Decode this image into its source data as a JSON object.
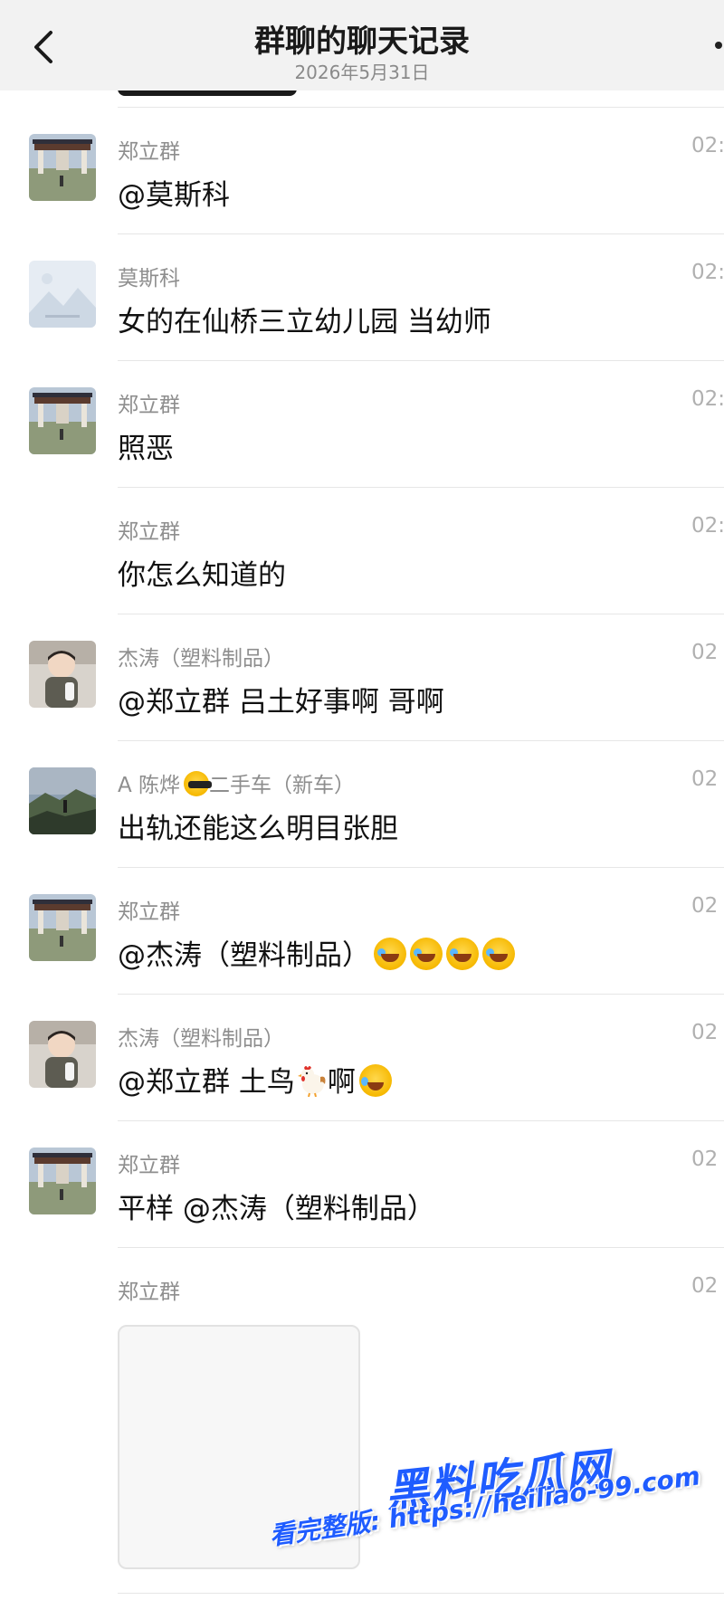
{
  "header": {
    "title": "群聊的聊天记录",
    "date": "2026年5月31日"
  },
  "colors": {
    "header_bg": "#f2f2f2",
    "sender_gray": "#8e8e8e",
    "divider": "#e6e6e6",
    "watermark_blue": "#1f5cff"
  },
  "messages": [
    {
      "sender": "郑立群",
      "time": "02:",
      "text": "@莫斯科",
      "avatar": "temple-gate-photo"
    },
    {
      "sender": "莫斯科",
      "time": "02:",
      "text": "女的在仙桥三立幼儿园 当幼师",
      "avatar": "default-landscape-placeholder"
    },
    {
      "sender": "郑立群",
      "time": "02:",
      "text": "照恶",
      "avatar": "temple-gate-photo"
    },
    {
      "sender": "郑立群",
      "time": "02:",
      "text": "你怎么知道的",
      "avatar": ""
    },
    {
      "sender": "杰涛（塑料制品）",
      "time": "02",
      "text": "@郑立群 吕土好事啊 哥啊",
      "avatar": "child-photo"
    },
    {
      "sender_prefix": "A 陈烨",
      "sender_suffix": "二手车（新车）",
      "sender_emoji": "smiling-face-with-sunglasses",
      "time": "02",
      "text": "出轨还能这么明目张胆",
      "avatar": "mountain-photo"
    },
    {
      "sender": "郑立群",
      "time": "02",
      "text": "@杰涛（塑料制品）",
      "emojis": [
        "rolling-on-floor-laughing",
        "rolling-on-floor-laughing",
        "rolling-on-floor-laughing",
        "rolling-on-floor-laughing"
      ],
      "avatar": "temple-gate-photo"
    },
    {
      "sender": "杰涛（塑料制品）",
      "time": "02",
      "text_a": "@郑立群 土鸟",
      "text_b": "啊",
      "emojis": [
        "chicken",
        "face-with-tears-of-joy"
      ],
      "avatar": "child-photo"
    },
    {
      "sender": "郑立群",
      "time": "02",
      "text": "平样 @杰涛（塑料制品）",
      "avatar": "temple-gate-photo"
    },
    {
      "sender": "郑立群",
      "time": "02",
      "type": "image",
      "avatar": ""
    }
  ],
  "watermark": {
    "logo": "黑料吃瓜网",
    "url": "看完整版: https://heiliao-99.com"
  }
}
